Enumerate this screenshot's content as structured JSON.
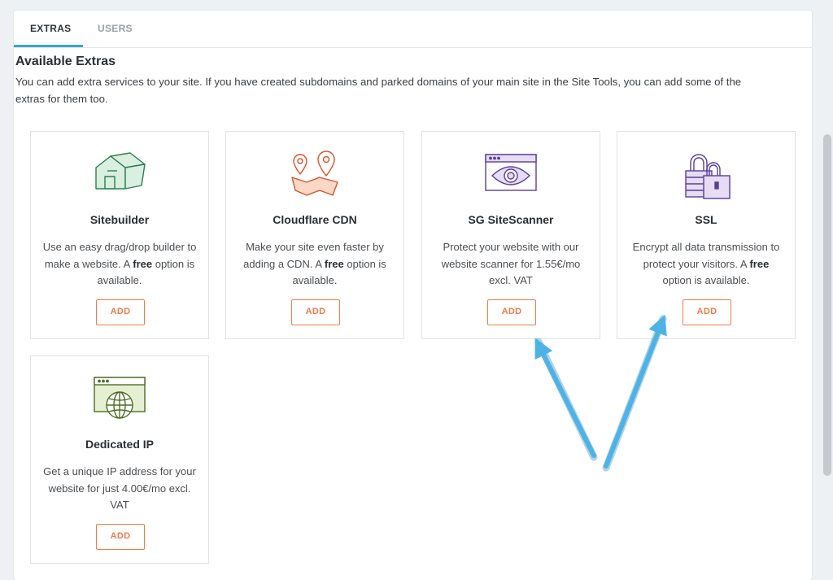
{
  "tabs": [
    {
      "label": "EXTRAS",
      "active": true
    },
    {
      "label": "USERS",
      "active": false
    }
  ],
  "heading": "Available Extras",
  "description": "You can add extra services to your site. If you have created subdomains and parked domains of your main site in the Site Tools, you can add some of the extras for them too.",
  "cards": [
    {
      "name": "Sitebuilder",
      "icon": "house-icon",
      "text_before": "Use an easy drag/drop builder to make a website. A ",
      "text_bold": "free",
      "text_after": " option is available.",
      "button": "ADD"
    },
    {
      "name": "Cloudflare CDN",
      "icon": "map-pins-icon",
      "text_before": "Make your site even faster by adding a CDN. A ",
      "text_bold": "free",
      "text_after": " option is available.",
      "button": "ADD"
    },
    {
      "name": "SG SiteScanner",
      "icon": "browser-eye-icon",
      "text_before": "Protect your website with our website scanner for 1.55€/mo excl. VAT",
      "text_bold": "",
      "text_after": "",
      "button": "ADD"
    },
    {
      "name": "SSL",
      "icon": "padlocks-icon",
      "text_before": "Encrypt all data transmission to protect your visitors. A ",
      "text_bold": "free",
      "text_after": " option is available.",
      "button": "ADD"
    },
    {
      "name": "Dedicated IP",
      "icon": "browser-globe-icon",
      "text_before": "Get a unique IP address for your website for just 4.00€/mo excl. VAT",
      "text_bold": "",
      "text_after": "",
      "button": "ADD"
    }
  ],
  "colors": {
    "accent": "#f07b4a",
    "tab_underline": "#3aa6c9",
    "annotation_arrow": "#4db3e6"
  }
}
